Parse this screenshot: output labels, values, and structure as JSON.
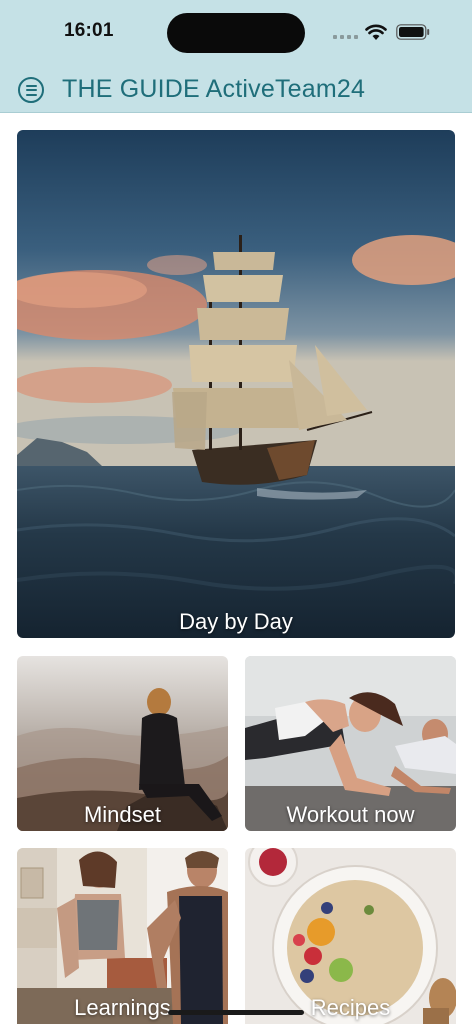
{
  "status_bar": {
    "time": "16:01",
    "icons": [
      "signal-icon",
      "wifi-icon",
      "battery-icon"
    ]
  },
  "header": {
    "menu_icon": "menu-icon",
    "title": "THE GUIDE ActiveTeam24"
  },
  "cards": {
    "hero": {
      "label": "Day by Day"
    },
    "mindset": {
      "label": "Mindset"
    },
    "workout": {
      "label": "Workout now"
    },
    "learnings": {
      "label": "Learnings"
    },
    "recipes": {
      "label": "Recipes"
    }
  },
  "colors": {
    "header_bg": "#c5e1e6",
    "accent": "#1f6e7a"
  }
}
